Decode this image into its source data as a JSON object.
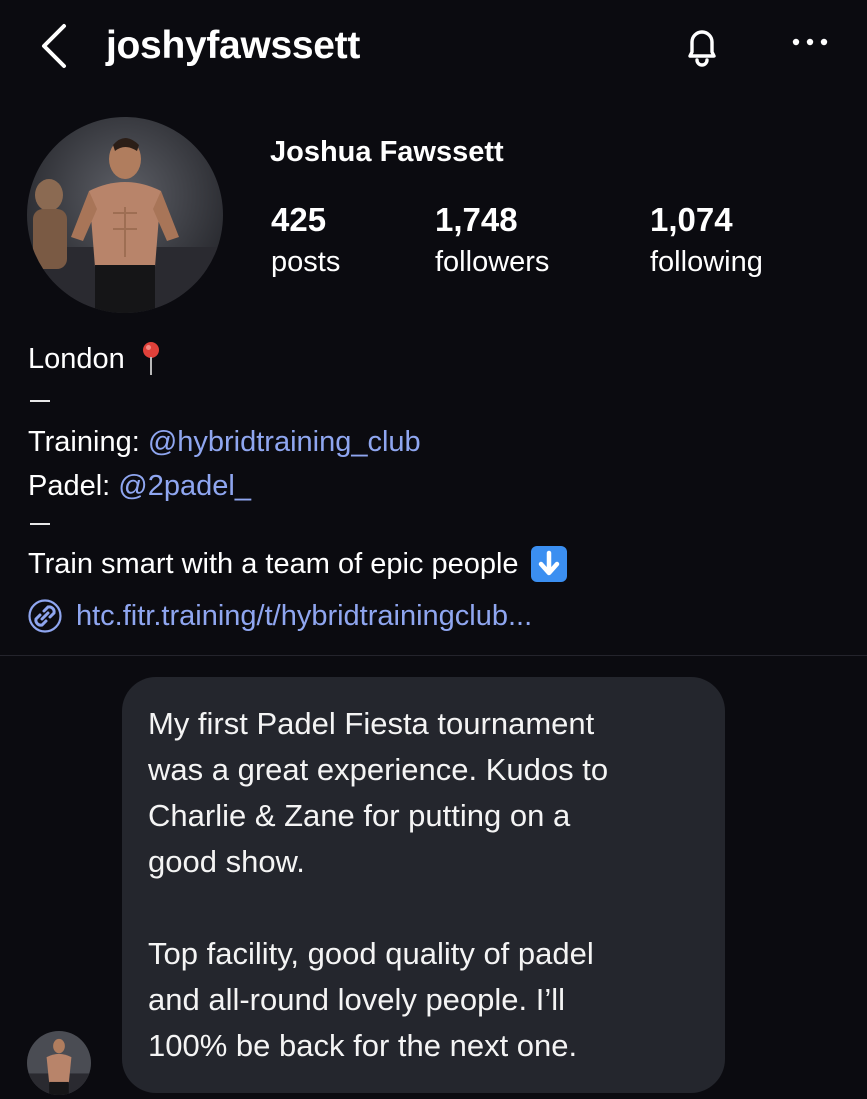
{
  "header": {
    "username": "joshyfawssett",
    "back_icon": "chevron-left-icon",
    "bell_icon": "bell-icon",
    "more_icon": "more-horizontal-icon"
  },
  "profile": {
    "full_name": "Joshua Fawssett",
    "stats": [
      {
        "value": "425",
        "label": "posts"
      },
      {
        "value": "1,748",
        "label": "followers"
      },
      {
        "value": "1,074",
        "label": "following"
      }
    ]
  },
  "bio": {
    "location": "London",
    "separator": "—",
    "training_prefix": "Training: ",
    "training_handle": "@hybridtraining_club",
    "padel_prefix": "Padel: ",
    "padel_handle": "@2padel_",
    "tagline": "Train smart with a team of epic people",
    "link": "htc.fitr.training/t/hybridtrainingclub..."
  },
  "message": {
    "paragraph1": "My first Padel Fiesta tournament\nwas a great experience. Kudos to\nCharlie & Zane for putting on a\ngood show.",
    "paragraph2": "Top facility, good quality of padel\nand all-round lovely people. I’ll\n100% be back for the next one."
  },
  "colors": {
    "background": "#0b0b10",
    "link": "#8fa6f0",
    "bubble": "#24262d"
  }
}
